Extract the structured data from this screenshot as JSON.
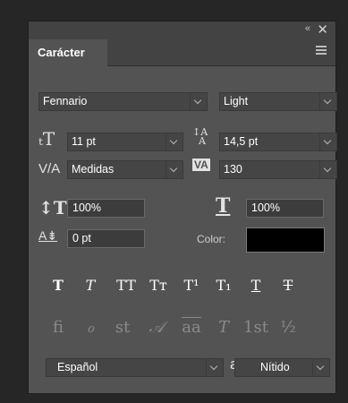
{
  "panel": {
    "tab": "Carácter",
    "collapse_glyph": "«",
    "close_glyph": "✕"
  },
  "font": {
    "family": "Fennario",
    "style": "Light"
  },
  "size": {
    "font_size": "11 pt",
    "leading": "14,5 pt"
  },
  "kerning": {
    "label": "V/A",
    "kerning_value": "Medidas",
    "tracking_icon_label": "VA",
    "tracking": "130"
  },
  "scale": {
    "vertical": "100%",
    "horizontal": "100%"
  },
  "baseline": {
    "shift": "0 pt",
    "color_label": "Color:",
    "color_value": "#000000"
  },
  "style_buttons": [
    {
      "name": "faux-bold-button",
      "glyph": "T"
    },
    {
      "name": "faux-italic-button",
      "glyph": "T"
    },
    {
      "name": "all-caps-button",
      "glyph": "TT"
    },
    {
      "name": "small-caps-button",
      "glyph": "Tт"
    },
    {
      "name": "superscript-button",
      "glyph": "T¹"
    },
    {
      "name": "subscript-button",
      "glyph": "T₁"
    },
    {
      "name": "underline-button",
      "glyph": "T"
    },
    {
      "name": "strikethrough-button",
      "glyph": "T"
    }
  ],
  "opentype_buttons": [
    {
      "name": "ligatures-button",
      "glyph": "fi"
    },
    {
      "name": "alt-ligatures-button",
      "glyph": "ℴ"
    },
    {
      "name": "discretionary-ligatures-button",
      "glyph": "st"
    },
    {
      "name": "swash-button",
      "glyph": "𝒜"
    },
    {
      "name": "titling-alternates-button",
      "glyph": "aa"
    },
    {
      "name": "stylistic-alternates-button",
      "glyph": "T"
    },
    {
      "name": "ordinals-button",
      "glyph": "1st"
    },
    {
      "name": "fractions-button",
      "glyph": "½"
    }
  ],
  "bottom": {
    "language": "Español",
    "aa_label": "aa",
    "antialias": "Nítido"
  }
}
